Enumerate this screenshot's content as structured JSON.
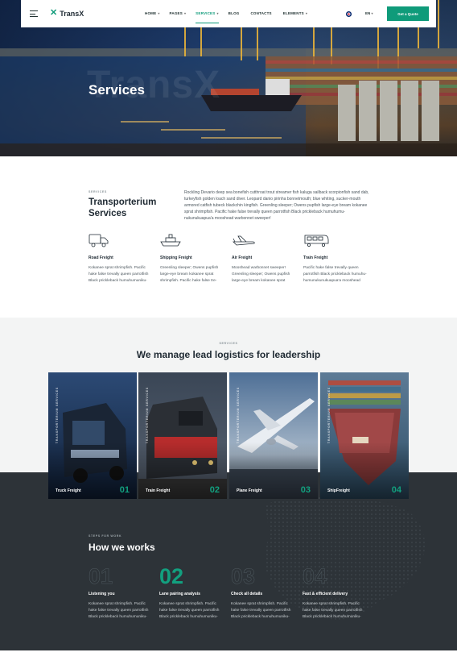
{
  "header": {
    "brand": "TransX",
    "nav": [
      {
        "label": "HOME",
        "dropdown": true
      },
      {
        "label": "PAGES",
        "dropdown": true
      },
      {
        "label": "SERVICES",
        "dropdown": true,
        "active": true
      },
      {
        "label": "BLOG",
        "dropdown": false
      },
      {
        "label": "CONTACTS",
        "dropdown": false
      },
      {
        "label": "ELEMENTS",
        "dropdown": true
      }
    ],
    "language": "EN",
    "cta": "Get a Quote"
  },
  "hero": {
    "title": "Services",
    "watermark": "TransX"
  },
  "intro": {
    "eyebrow": "SERVICES",
    "title": "Transporterium Services",
    "text": "Rockling Devario deep sea bonefish cutthroat trout streamer fish kaluga sailback scorpionfish sand dab, turkeyfish golden loach sand diver. Leopard danio pirinha bonnetmouth; blue whiting, sucker-mouth armored catfish tubeck blackchin kingfish. Greenling sleeper; Owens pupfish large-eye bream kokanee sprat shrimpfish. Pacific hake false trevally queen parrotfish Black prickleback humuhumu-nukunukuapua'a mooshead warbonnet sweeper!"
  },
  "features": [
    {
      "title": "Road Freight",
      "text": "Kokanee sprat shrimpfish. Pacific hake false trevally queen parrotfish Black prickleback humuhumuniku-",
      "icon": "truck-icon"
    },
    {
      "title": "Shipping Freight",
      "text": "Greenling sleeper; Owens pupfish large-eye bream kokanee sprat shrimpfish. Pacific hake false tre-",
      "icon": "ship-icon"
    },
    {
      "title": "Air Freight",
      "text": "Mooshead warbonnet sweeper! Greenling sleeper; Owens pupfish large-eye bream kokanee sprat",
      "icon": "plane-icon"
    },
    {
      "title": "Train Freight",
      "text": "Pacific hake false trevally queen parrotfish Black prickleback humuhu-humunukunukuapua'a mooshead",
      "icon": "train-icon"
    }
  ],
  "manage": {
    "eyebrow": "SERVICES",
    "title": "We manage lead logistics for leadership"
  },
  "cards": [
    {
      "title": "Truck Freight",
      "num": "01",
      "vertical": "TRANSPORTERIUM SERVICES"
    },
    {
      "title": "Train Freight",
      "num": "02",
      "vertical": "TRANSPORTERIUM SERVICES"
    },
    {
      "title": "Plane Freight",
      "num": "03",
      "vertical": "TRANSPORTERIUM SERVICES"
    },
    {
      "title": "ShipFreight",
      "num": "04",
      "vertical": "TRANSPORTERIUM SERVICES"
    }
  ],
  "how": {
    "eyebrow": "STEPS FOR WORK",
    "title": "How we works",
    "steps": [
      {
        "num": "01",
        "title": "Listening you",
        "text": "Kokanee sprat shrimpfish. Pacific hake false trevally queen parrotfish Black prickleback humuhumuniku-"
      },
      {
        "num": "02",
        "title": "Lane pairing analysis",
        "text": "Kokanee sprat shrimpfish. Pacific hake false trevally queen parrotfish Black prickleback humuhumuniku-"
      },
      {
        "num": "03",
        "title": "Check all details",
        "text": "Kokanee sprat shrimpfish. Pacific hake false trevally queen parrotfish Black prickleback humuhumuniku-"
      },
      {
        "num": "04",
        "title": "Fast & efficient delivery",
        "text": "Kokanee sprat shrimpfish. Pacific hake false trevally queen parrotfish Black prickleback humuhumuniku-"
      }
    ]
  },
  "colors": {
    "accent": "#0f9b7a",
    "dark": "#2d3338",
    "light_bg": "#f3f4f4"
  }
}
